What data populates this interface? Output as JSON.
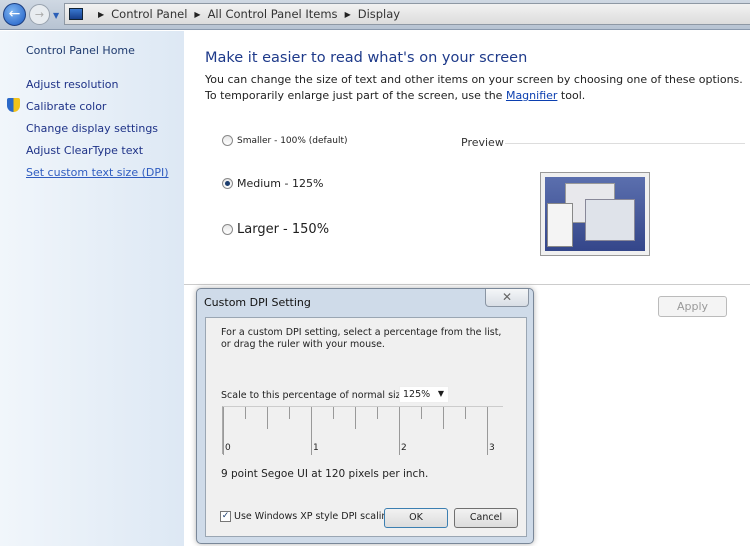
{
  "breadcrumb": [
    "Control Panel",
    "All Control Panel Items",
    "Display"
  ],
  "sidebar": {
    "home": "Control Panel Home",
    "items": [
      "Adjust resolution",
      "Calibrate color",
      "Change display settings",
      "Adjust ClearType text",
      "Set custom text size (DPI)"
    ]
  },
  "main": {
    "title": "Make it easier to read what's on your screen",
    "desc_before": "You can change the size of text and other items on your screen by choosing one of these options. To temporarily enlarge just part of the screen, use the ",
    "link": "Magnifier",
    "desc_after": " tool.",
    "options": [
      "Smaller - 100% (default)",
      "Medium - 125%",
      "Larger - 150%"
    ],
    "selected": "Medium - 125%",
    "preview": "Preview",
    "apply": "Apply"
  },
  "dialog": {
    "title": "Custom DPI Setting",
    "close": "✕",
    "instructions": "For a custom DPI setting, select a percentage from the list, or drag the ruler with your mouse.",
    "scale_label": "Scale to this percentage of normal size:",
    "scale_value": "125%",
    "ruler_labels": [
      "0",
      "1",
      "2",
      "3"
    ],
    "info": "9 point Segoe UI at 120 pixels per inch.",
    "xp_scaling": "Use Windows XP style DPI scaling",
    "xp_checked": true,
    "ok": "OK",
    "cancel": "Cancel"
  }
}
